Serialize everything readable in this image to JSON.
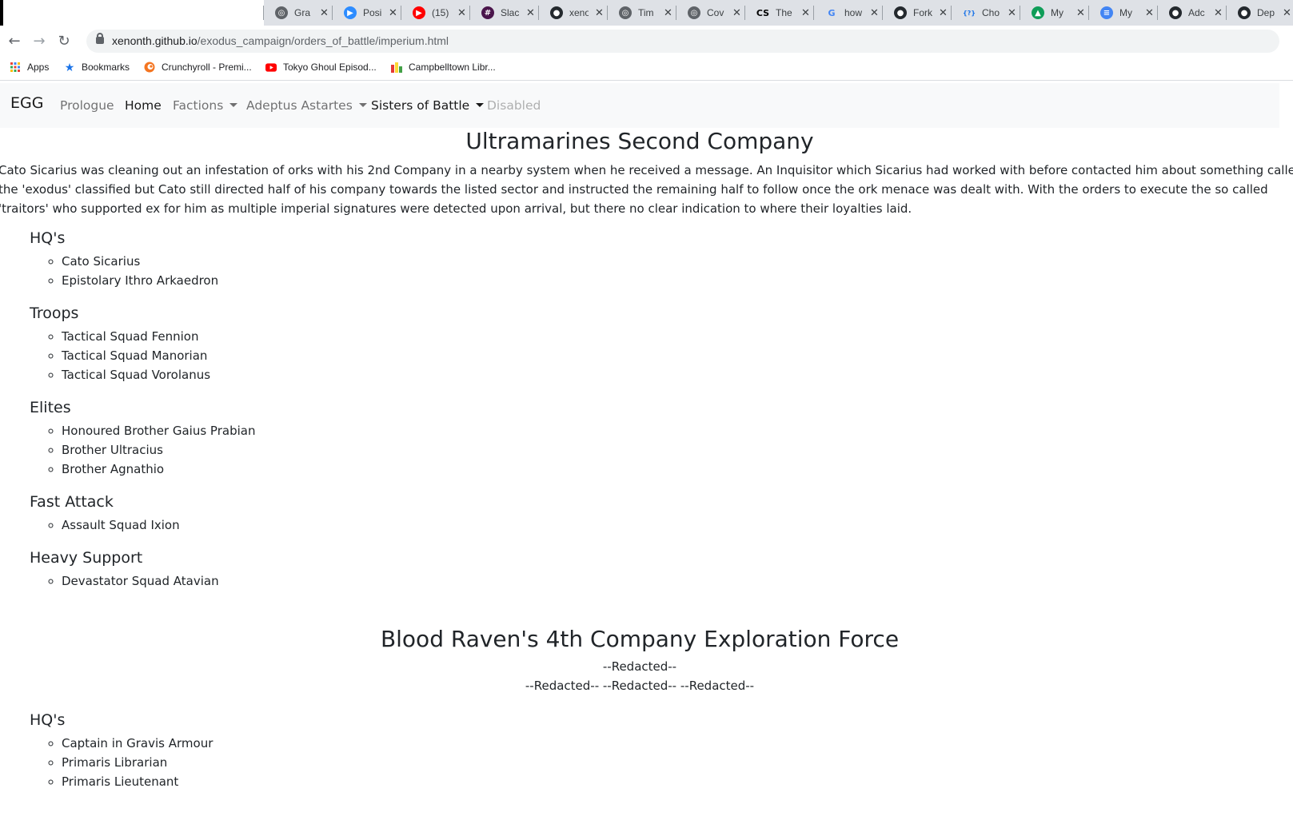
{
  "browser": {
    "tabs": [
      {
        "title": "Gra",
        "icon": "globe-icon",
        "color": "#5f6368"
      },
      {
        "title": "Posi",
        "icon": "zoom-icon",
        "color": "#2d8cff"
      },
      {
        "title": "(15)",
        "icon": "youtube-icon",
        "color": "#ff0000"
      },
      {
        "title": "Slac",
        "icon": "slack-icon",
        "color": "#4a154b"
      },
      {
        "title": "xeno",
        "icon": "github-icon",
        "color": "#24292e"
      },
      {
        "title": "Tim",
        "icon": "globe-icon",
        "color": "#5f6368"
      },
      {
        "title": "Cov",
        "icon": "globe-icon",
        "color": "#5f6368"
      },
      {
        "title": "The",
        "icon": "cs-icon",
        "color": "#000000"
      },
      {
        "title": "how",
        "icon": "google-icon",
        "color": "#4285f4"
      },
      {
        "title": "Fork",
        "icon": "github-icon",
        "color": "#24292e"
      },
      {
        "title": "Cho",
        "icon": "code-icon",
        "color": "#1a73e8"
      },
      {
        "title": "My",
        "icon": "drive-icon",
        "color": "#0f9d58"
      },
      {
        "title": "My",
        "icon": "docs-icon",
        "color": "#4285f4"
      },
      {
        "title": "Adc",
        "icon": "github-icon",
        "color": "#24292e"
      },
      {
        "title": "Dep",
        "icon": "github-icon",
        "color": "#24292e"
      }
    ],
    "url_domain": "xenonth.github.io",
    "url_path": "/exodus_campaign/orders_of_battle/imperium.html",
    "bookmarks": [
      {
        "label": "Apps",
        "icon": "apps-grid-icon"
      },
      {
        "label": "Bookmarks",
        "icon": "star-icon"
      },
      {
        "label": "Crunchyroll - Premi...",
        "icon": "crunchyroll-icon"
      },
      {
        "label": "Tokyo Ghoul Episod...",
        "icon": "youtube-icon"
      },
      {
        "label": "Campbelltown Libr...",
        "icon": "library-icon"
      }
    ]
  },
  "navbar": {
    "brand": "EGG",
    "prologue": "Prologue",
    "home": "Home",
    "factions": "Factions",
    "astartes": "Adeptus Astartes",
    "sisters": "Sisters of Battle",
    "disabled": "Disabled"
  },
  "company1": {
    "title": "Ultramarines Second Company",
    "intro": "Cato Sicarius was cleaning out an infestation of orks with his 2nd Company in a nearby system when he received a message. An Inquisitor which Sicarius had worked with before contacted him about something called the 'exodus' classified but Cato still directed half of his company towards the listed sector and instructed the remaining half to follow once the ork menace was dealt with. With the orders to execute the so called 'traitors' who supported ex for him as multiple imperial signatures were detected upon arrival, but there no clear indication to where their loyalties laid.",
    "sections": [
      {
        "heading": "HQ's",
        "items": [
          "Cato Sicarius",
          "Epistolary Ithro Arkaedron"
        ]
      },
      {
        "heading": "Troops",
        "items": [
          "Tactical Squad Fennion",
          "Tactical Squad Manorian",
          "Tactical Squad Vorolanus"
        ]
      },
      {
        "heading": "Elites",
        "items": [
          "Honoured Brother Gaius Prabian",
          "Brother Ultracius",
          "Brother Agnathio"
        ]
      },
      {
        "heading": "Fast Attack",
        "items": [
          "Assault Squad Ixion"
        ]
      },
      {
        "heading": "Heavy Support",
        "items": [
          "Devastator Squad Atavian"
        ]
      }
    ]
  },
  "company2": {
    "title": "Blood Raven's 4th Company Exploration Force",
    "redacted1": "--Redacted--",
    "redacted2": "--Redacted-- --Redacted-- --Redacted--",
    "sections": [
      {
        "heading": "HQ's",
        "items": [
          "Captain in Gravis Armour",
          "Primaris Librarian",
          "Primaris Lieutenant"
        ]
      }
    ]
  }
}
